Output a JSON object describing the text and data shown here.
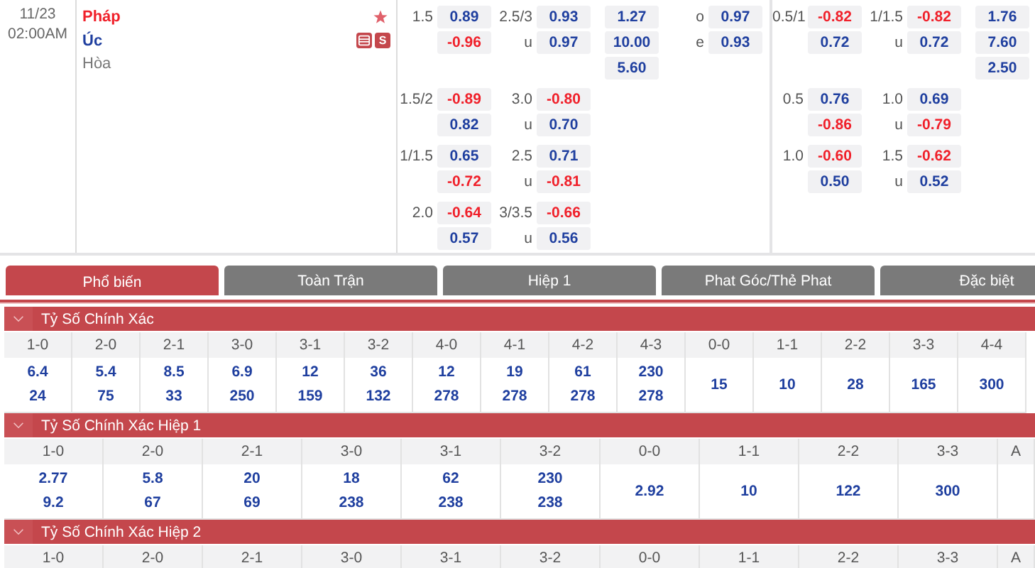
{
  "match": {
    "date": "11/23",
    "time": "02:00AM",
    "home": "Pháp",
    "away": "Úc",
    "draw": "Hòa",
    "favorite": true,
    "badge": "S"
  },
  "full_time": [
    {
      "handicap": {
        "line": "1.5",
        "odds": [
          {
            "value": "0.89",
            "negative": false
          },
          {
            "value": "-0.96",
            "negative": true
          }
        ]
      },
      "over_under": {
        "line": "2.5/3",
        "under_label": "u",
        "odds": [
          {
            "value": "0.93",
            "negative": false
          },
          {
            "value": "0.97",
            "negative": false
          }
        ]
      },
      "one_x_two": [
        "1.27",
        "10.00",
        "5.60"
      ],
      "odd_even": [
        {
          "label": "o",
          "value": "0.97"
        },
        {
          "label": "e",
          "value": "0.93"
        }
      ]
    },
    {
      "handicap": {
        "line": "1.5/2",
        "odds": [
          {
            "value": "-0.89",
            "negative": true
          },
          {
            "value": "0.82",
            "negative": false
          }
        ]
      },
      "over_under": {
        "line": "3.0",
        "under_label": "u",
        "odds": [
          {
            "value": "-0.80",
            "negative": true
          },
          {
            "value": "0.70",
            "negative": false
          }
        ]
      }
    },
    {
      "handicap": {
        "line": "1/1.5",
        "odds": [
          {
            "value": "0.65",
            "negative": false
          },
          {
            "value": "-0.72",
            "negative": true
          }
        ]
      },
      "over_under": {
        "line": "2.5",
        "under_label": "u",
        "odds": [
          {
            "value": "0.71",
            "negative": false
          },
          {
            "value": "-0.81",
            "negative": true
          }
        ]
      }
    },
    {
      "handicap": {
        "line": "2.0",
        "odds": [
          {
            "value": "-0.64",
            "negative": true
          },
          {
            "value": "0.57",
            "negative": false
          }
        ]
      },
      "over_under": {
        "line": "3/3.5",
        "under_label": "u",
        "odds": [
          {
            "value": "-0.66",
            "negative": true
          },
          {
            "value": "0.56",
            "negative": false
          }
        ]
      }
    }
  ],
  "first_half": [
    {
      "handicap": {
        "line": "0.5/1",
        "odds": [
          {
            "value": "-0.82",
            "negative": true
          },
          {
            "value": "0.72",
            "negative": false
          }
        ]
      },
      "over_under": {
        "line": "1/1.5",
        "under_label": "u",
        "odds": [
          {
            "value": "-0.82",
            "negative": true
          },
          {
            "value": "0.72",
            "negative": false
          }
        ]
      },
      "one_x_two": [
        "1.76",
        "7.60",
        "2.50"
      ]
    },
    {
      "handicap": {
        "line": "0.5",
        "odds": [
          {
            "value": "0.76",
            "negative": false
          },
          {
            "value": "-0.86",
            "negative": true
          }
        ]
      },
      "over_under": {
        "line": "1.0",
        "under_label": "u",
        "odds": [
          {
            "value": "0.69",
            "negative": false
          },
          {
            "value": "-0.79",
            "negative": true
          }
        ]
      }
    },
    {
      "handicap": {
        "line": "1.0",
        "odds": [
          {
            "value": "-0.60",
            "negative": true
          },
          {
            "value": "0.50",
            "negative": false
          }
        ]
      },
      "over_under": {
        "line": "1.5",
        "under_label": "u",
        "odds": [
          {
            "value": "-0.62",
            "negative": true
          },
          {
            "value": "0.52",
            "negative": false
          }
        ]
      }
    }
  ],
  "tabs": [
    {
      "label": "Phổ biến",
      "selected": true
    },
    {
      "label": "Toàn Trận",
      "selected": false
    },
    {
      "label": "Hiệp 1",
      "selected": false
    },
    {
      "label": "Phat Góc/Thẻ Phat",
      "selected": false
    },
    {
      "label": "Đặc biệt",
      "selected": false
    }
  ],
  "sections": [
    {
      "title": "Tỷ Số Chính Xác",
      "expanded": true,
      "columns": [
        {
          "score": "1-0",
          "values": [
            "6.4",
            "24"
          ]
        },
        {
          "score": "2-0",
          "values": [
            "5.4",
            "75"
          ]
        },
        {
          "score": "2-1",
          "values": [
            "8.5",
            "33"
          ]
        },
        {
          "score": "3-0",
          "values": [
            "6.9",
            "250"
          ]
        },
        {
          "score": "3-1",
          "values": [
            "12",
            "159"
          ]
        },
        {
          "score": "3-2",
          "values": [
            "36",
            "132"
          ]
        },
        {
          "score": "4-0",
          "values": [
            "12",
            "278"
          ]
        },
        {
          "score": "4-1",
          "values": [
            "19",
            "278"
          ]
        },
        {
          "score": "4-2",
          "values": [
            "61",
            "278"
          ]
        },
        {
          "score": "4-3",
          "values": [
            "230",
            "278"
          ]
        },
        {
          "score": "0-0",
          "values": [
            "15"
          ]
        },
        {
          "score": "1-1",
          "values": [
            "10"
          ]
        },
        {
          "score": "2-2",
          "values": [
            "28"
          ]
        },
        {
          "score": "3-3",
          "values": [
            "165"
          ]
        },
        {
          "score": "4-4",
          "values": [
            "300"
          ]
        }
      ]
    },
    {
      "title": "Tỷ Số Chính Xác Hiệp 1",
      "expanded": true,
      "columns": [
        {
          "score": "1-0",
          "values": [
            "2.77",
            "9.2"
          ]
        },
        {
          "score": "2-0",
          "values": [
            "5.8",
            "67"
          ]
        },
        {
          "score": "2-1",
          "values": [
            "20",
            "69"
          ]
        },
        {
          "score": "3-0",
          "values": [
            "18",
            "238"
          ]
        },
        {
          "score": "3-1",
          "values": [
            "62",
            "238"
          ]
        },
        {
          "score": "3-2",
          "values": [
            "230",
            "238"
          ]
        },
        {
          "score": "0-0",
          "values": [
            "2.92"
          ]
        },
        {
          "score": "1-1",
          "values": [
            "10"
          ]
        },
        {
          "score": "2-2",
          "values": [
            "122"
          ]
        },
        {
          "score": "3-3",
          "values": [
            "300"
          ]
        },
        {
          "score": "A"
        }
      ]
    },
    {
      "title": "Tỷ Số Chính Xác Hiệp 2",
      "expanded": true,
      "columns": [
        {
          "score": "1-0"
        },
        {
          "score": "2-0"
        },
        {
          "score": "2-1"
        },
        {
          "score": "3-0"
        },
        {
          "score": "3-1"
        },
        {
          "score": "3-2"
        },
        {
          "score": "0-0"
        },
        {
          "score": "1-1"
        },
        {
          "score": "2-2"
        },
        {
          "score": "3-3"
        },
        {
          "score": "A"
        }
      ]
    }
  ]
}
